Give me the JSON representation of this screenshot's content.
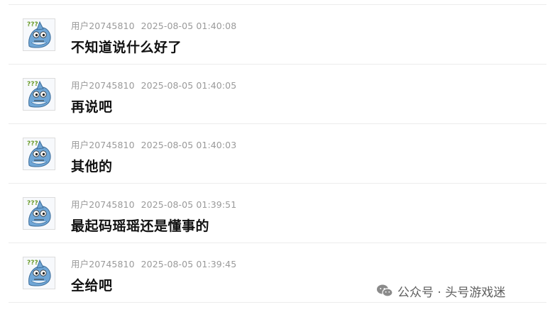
{
  "comments": [
    {
      "user": "用户20745810",
      "time": "2025-08-05 01:40:08",
      "text": "不知道说什么好了",
      "avatar_icon": "shark-cartoon-icon"
    },
    {
      "user": "用户20745810",
      "time": "2025-08-05 01:40:05",
      "text": "再说吧",
      "avatar_icon": "shark-cartoon-icon"
    },
    {
      "user": "用户20745810",
      "time": "2025-08-05 01:40:03",
      "text": "其他的",
      "avatar_icon": "shark-cartoon-icon"
    },
    {
      "user": "用户20745810",
      "time": "2025-08-05 01:39:51",
      "text": "最起码瑶瑶还是懂事的",
      "avatar_icon": "shark-cartoon-icon"
    },
    {
      "user": "用户20745810",
      "time": "2025-08-05 01:39:45",
      "text": "全给吧",
      "avatar_icon": "shark-cartoon-icon"
    }
  ],
  "watermark": {
    "text": "公众号 · 头号游戏迷",
    "icon": "wechat-icon"
  },
  "colors": {
    "meta_text": "#9a9a9a",
    "comment_text": "#111111",
    "divider": "#ececec",
    "avatar_shark": "#6fa6d6"
  }
}
